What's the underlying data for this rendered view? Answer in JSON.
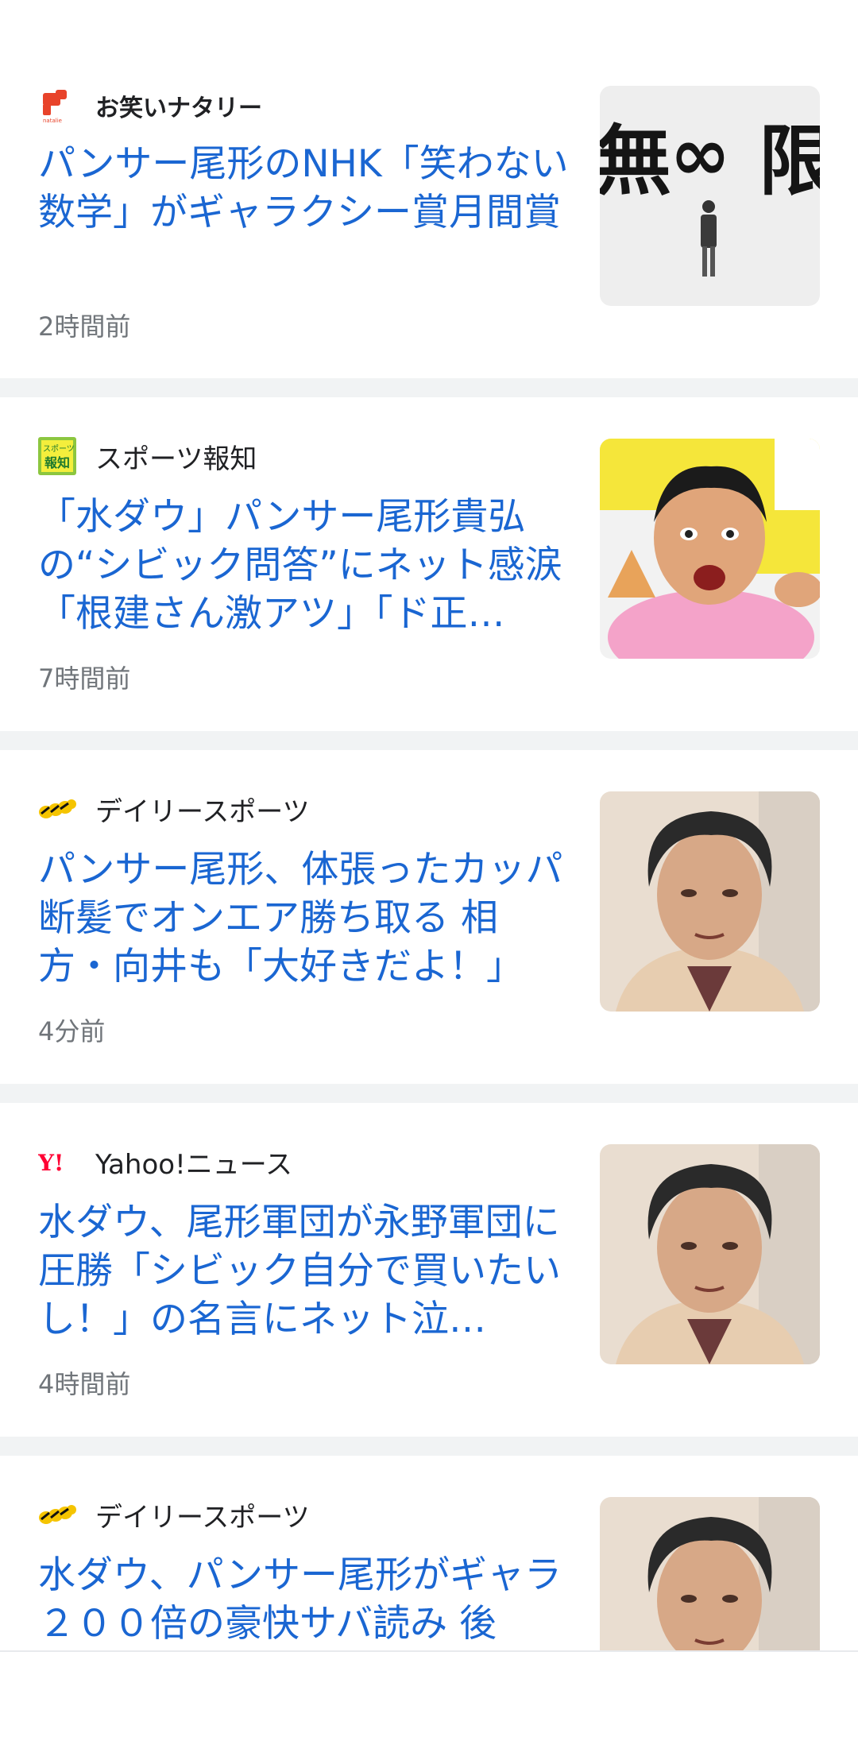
{
  "articles": [
    {
      "source": "お笑いナタリー",
      "logo_icon": "natalie-logo-icon",
      "headline": "パンサー尾形のNHK「笑わない数学」がギャラクシー賞月間賞",
      "time": "2時間前",
      "thumb_icon": "infinity-poster-thumbnail"
    },
    {
      "source": "スポーツ報知",
      "logo_icon": "hochi-logo-icon",
      "headline": "「水ダウ」パンサー尾形貴弘の“シビック問答”にネット感涙「根建さん激アツ」「ド正…",
      "time": "7時間前",
      "thumb_icon": "man-pointing-thumbnail"
    },
    {
      "source": "デイリースポーツ",
      "logo_icon": "daily-logo-icon",
      "headline": "パンサー尾形、体張ったカッパ断髪でオンエア勝ち取る 相方・向井も「大好きだよ！」",
      "time": "4分前",
      "thumb_icon": "man-portrait-thumbnail"
    },
    {
      "source": "Yahoo!ニュース",
      "logo_icon": "yahoo-logo-icon",
      "headline": "水ダウ、尾形軍団が永野軍団に圧勝「シビック自分で買いたいし！」の名言にネット泣…",
      "time": "4時間前",
      "thumb_icon": "man-portrait-thumbnail"
    },
    {
      "source": "デイリースポーツ",
      "logo_icon": "daily-logo-icon",
      "headline": "水ダウ、パンサー尾形がギャラ２００倍の豪快サバ読み 後",
      "time": "",
      "thumb_icon": "man-portrait-thumbnail"
    }
  ],
  "colors": {
    "headline": "#1a66d2",
    "source": "#202124",
    "time": "#70757a",
    "separator": "#f1f3f4"
  }
}
